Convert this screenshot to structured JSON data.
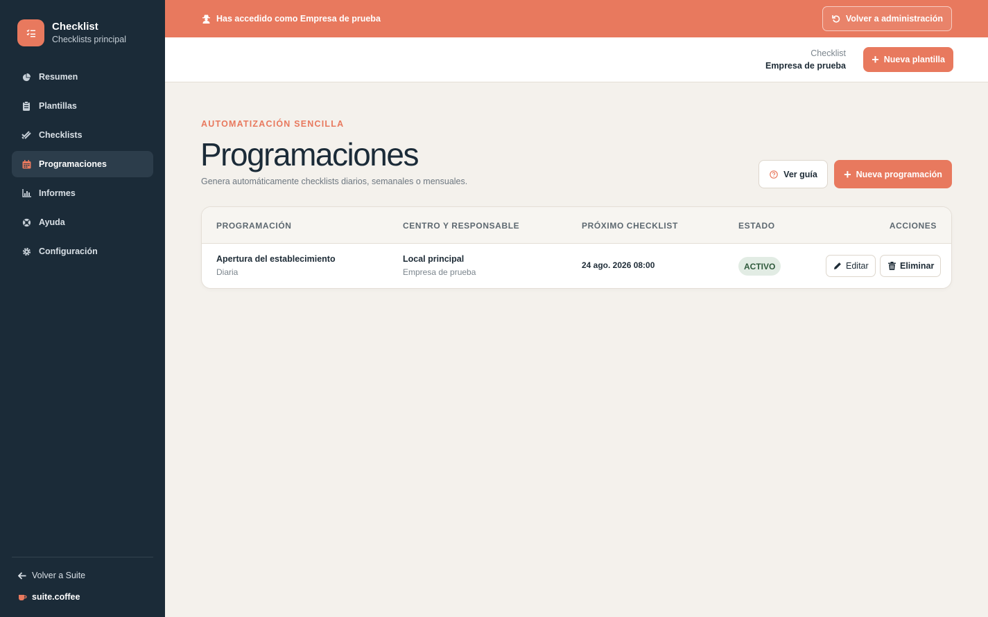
{
  "sidebar": {
    "brand_title": "Checklist",
    "brand_subtitle": "Checklists principal",
    "items": [
      {
        "label": "Resumen",
        "icon": "pie-chart-icon"
      },
      {
        "label": "Plantillas",
        "icon": "clipboard-icon"
      },
      {
        "label": "Checklists",
        "icon": "check-double-icon"
      },
      {
        "label": "Programaciones",
        "icon": "calendar-icon",
        "active": true
      },
      {
        "label": "Informes",
        "icon": "bar-chart-icon"
      },
      {
        "label": "Ayuda",
        "icon": "lifebuoy-icon"
      },
      {
        "label": "Configuración",
        "icon": "gear-icon"
      }
    ],
    "back_label": "Volver a Suite",
    "suite_brand": "suite.coffee"
  },
  "banner": {
    "text": "Has accedido como Empresa de prueba",
    "button_label": "Volver a administración"
  },
  "topbar": {
    "app_name": "Checklist",
    "company": "Empresa de prueba",
    "new_template_label": "Nueva plantilla"
  },
  "main": {
    "eyebrow": "AUTOMATIZACIÓN SENCILLA",
    "title": "Programaciones",
    "subtitle": "Genera automáticamente checklists diarios, semanales o mensuales.",
    "guide_label": "Ver guía",
    "new_schedule_label": "Nueva programación"
  },
  "table": {
    "columns": [
      "PROGRAMACIÓN",
      "CENTRO Y RESPONSABLE",
      "PRÓXIMO CHECKLIST",
      "ESTADO",
      "ACCIONES"
    ],
    "rows": [
      {
        "name": "Apertura del establecimiento",
        "frequency": "Diaria",
        "center": "Local principal",
        "responsible": "Empresa de prueba",
        "next": "24 ago. 2026 08:00",
        "status": "ACTIVO",
        "edit_label": "Editar",
        "delete_label": "Eliminar"
      }
    ]
  },
  "colors": {
    "accent": "#e8795e",
    "sidebar_bg": "#1b2b38",
    "page_bg": "#f4f1ec",
    "status_active_bg": "#e2ece4"
  }
}
